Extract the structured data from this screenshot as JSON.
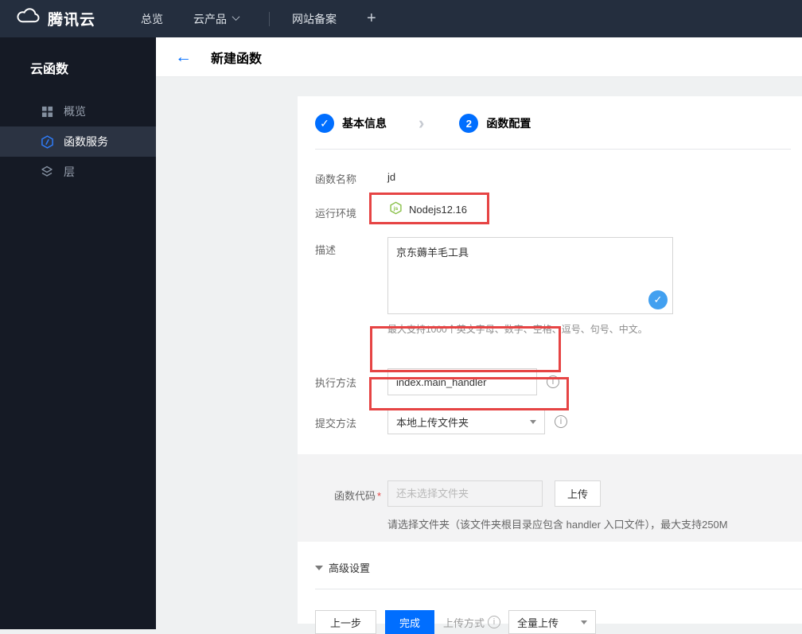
{
  "navbar": {
    "brand": "腾讯云",
    "overview": "总览",
    "products": "云产品",
    "icp": "网站备案",
    "plus": "+"
  },
  "sidebar": {
    "title": "云函数",
    "items": [
      {
        "label": "概览",
        "icon": "grid-overview-icon"
      },
      {
        "label": "函数服务",
        "icon": "function-hexagon-icon"
      },
      {
        "label": "层",
        "icon": "layers-icon"
      }
    ]
  },
  "header": {
    "back_arrow": "←",
    "title": "新建函数"
  },
  "steps": {
    "step1_glyph": "✓",
    "step1_label": "基本信息",
    "arrow": "›",
    "step2_num": "2",
    "step2_label": "函数配置"
  },
  "form": {
    "name_label": "函数名称",
    "name_value": "jd",
    "runtime_label": "运行环境",
    "runtime_value": "Nodejs12.16",
    "desc_label": "描述",
    "desc_value": "京东薅羊毛工具",
    "desc_check": "✓",
    "desc_hint": "最大支持1000个英文字母、数字、空格、逗号、句号、中文。",
    "handler_label": "执行方法",
    "handler_value": "index.main_handler",
    "submit_label": "提交方法",
    "submit_value": "本地上传文件夹",
    "code_label": "函数代码",
    "required_mark": "*",
    "code_placeholder": "还未选择文件夹",
    "upload_button": "上传",
    "code_hint": "请选择文件夹（该文件夹根目录应包含 handler 入口文件），最大支持250M",
    "advanced_label": "高级设置",
    "info_glyph": "i"
  },
  "actions": {
    "prev": "上一步",
    "done": "完成",
    "upload_mode_label": "上传方式",
    "upload_mode_value": "全量上传"
  },
  "colors": {
    "accent_blue": "#006eff",
    "annotation_red": "#e64444",
    "node_green": "#83bd3f",
    "check_blue": "#42a0f0",
    "navbar_bg": "#242e3e",
    "sidebar_bg": "#151a25"
  }
}
